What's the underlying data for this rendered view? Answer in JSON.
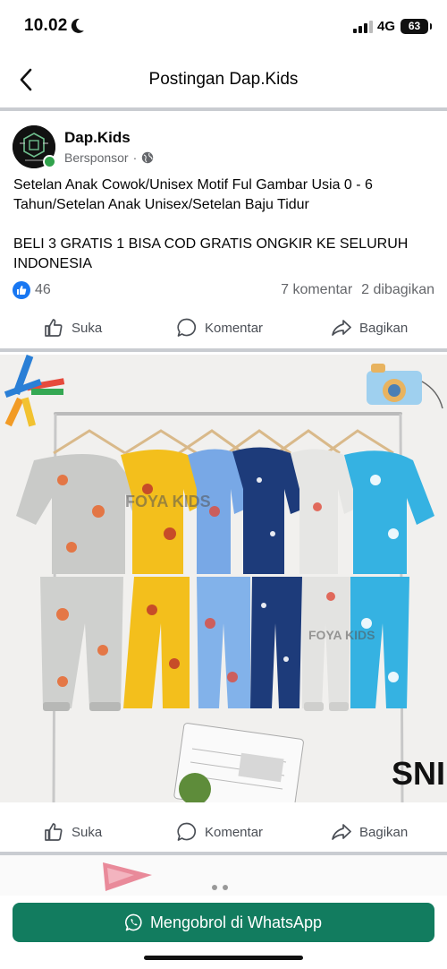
{
  "status_bar": {
    "time": "10.02",
    "network": "4G",
    "battery": "63"
  },
  "header": {
    "title": "Postingan Dap.Kids"
  },
  "post": {
    "page_name": "Dap.Kids",
    "sponsored_label": "Bersponsor",
    "text_lines": [
      "Setelan Anak Cowok/Unisex Motif Ful Gambar Usia 0 - 6 Tahun/Setelan Anak Unisex/Setelan Baju Tidur",
      "BELI 3 GRATIS 1 BISA COD GRATIS ONGKIR KE SELURUH INDONESIA"
    ],
    "like_count": "46",
    "comments": "7 komentar",
    "shares": "2 dibagikan",
    "actions": {
      "like": "Suka",
      "comment": "Komentar",
      "share": "Bagikan"
    },
    "image_watermark": "FOYA KIDS",
    "sni_mark": "SNI",
    "like_icon": "thumbs-up-icon",
    "comment_icon": "comment-bubble-icon",
    "share_icon": "share-arrow-icon"
  },
  "cta": {
    "label": "Mengobrol di WhatsApp",
    "icon": "whatsapp-icon",
    "color": "#127c5f"
  },
  "colors": {
    "facebook_blue": "#1877f2",
    "online_green": "#31a24c"
  }
}
